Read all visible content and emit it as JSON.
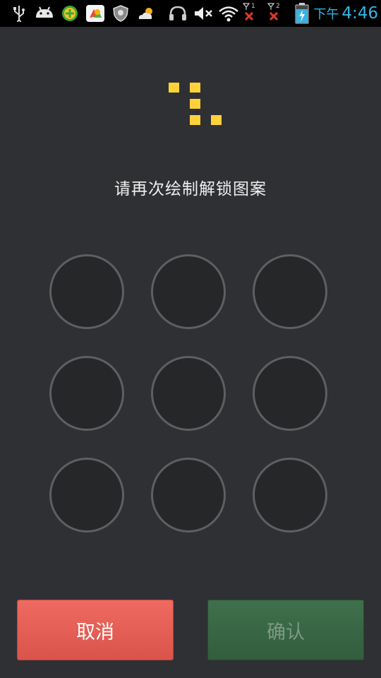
{
  "status_bar": {
    "icons": [
      "usb-icon",
      "android-debug-icon",
      "app-plus-icon",
      "app-color-icon",
      "shield-icon",
      "weather-cloud-sun-icon",
      "headphones-icon",
      "volume-muted-icon",
      "wifi-icon",
      "sim1-no-signal-icon",
      "sim2-no-signal-icon",
      "battery-charging-icon"
    ],
    "sim1_label": "1",
    "sim2_label": "2",
    "ampm": "下午",
    "time": "4:46",
    "accent_color": "#33b5e5"
  },
  "pattern_preview": {
    "drawn_cells": [
      [
        0,
        0
      ],
      [
        0,
        1
      ],
      [
        1,
        1
      ],
      [
        2,
        1
      ],
      [
        2,
        2
      ]
    ],
    "color": "#ffd23a"
  },
  "instruction": "请再次绘制解锁图案",
  "grid": {
    "rows": 3,
    "cols": 3
  },
  "buttons": {
    "cancel_label": "取消",
    "confirm_label": "确认",
    "cancel_color": "#e05b52",
    "confirm_color": "#3a6646"
  }
}
